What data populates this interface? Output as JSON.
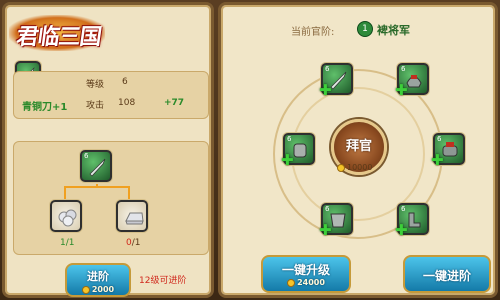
{
  "logo": {
    "text": "君临三国"
  },
  "rank": {
    "label": "当前官阶:",
    "badge": "1",
    "value": "裨将军"
  },
  "item": {
    "name": "青铜刀+1",
    "level_label": "等级",
    "level_value": "6",
    "stat_label": "攻击",
    "stat_value": "108",
    "stat_bonus": "+77"
  },
  "materials": [
    {
      "name": "silver-ore",
      "have": "1",
      "need": "1"
    },
    {
      "name": "silver-ingot",
      "have": "0",
      "need": "1"
    }
  ],
  "advance": {
    "label": "进阶",
    "cost": "2000",
    "hint": "12级可进阶"
  },
  "center": {
    "label": "拜官",
    "cost": "10000"
  },
  "slots_level": "6",
  "buttons": {
    "upgrade_all_label": "一键升级",
    "upgrade_all_cost": "24000",
    "advance_all_label": "一键进阶"
  },
  "colors": {
    "accent": "#1a8ec0",
    "frame": "#7a5a30",
    "slot": "#2e7a3a",
    "hint": "#d0281c"
  }
}
